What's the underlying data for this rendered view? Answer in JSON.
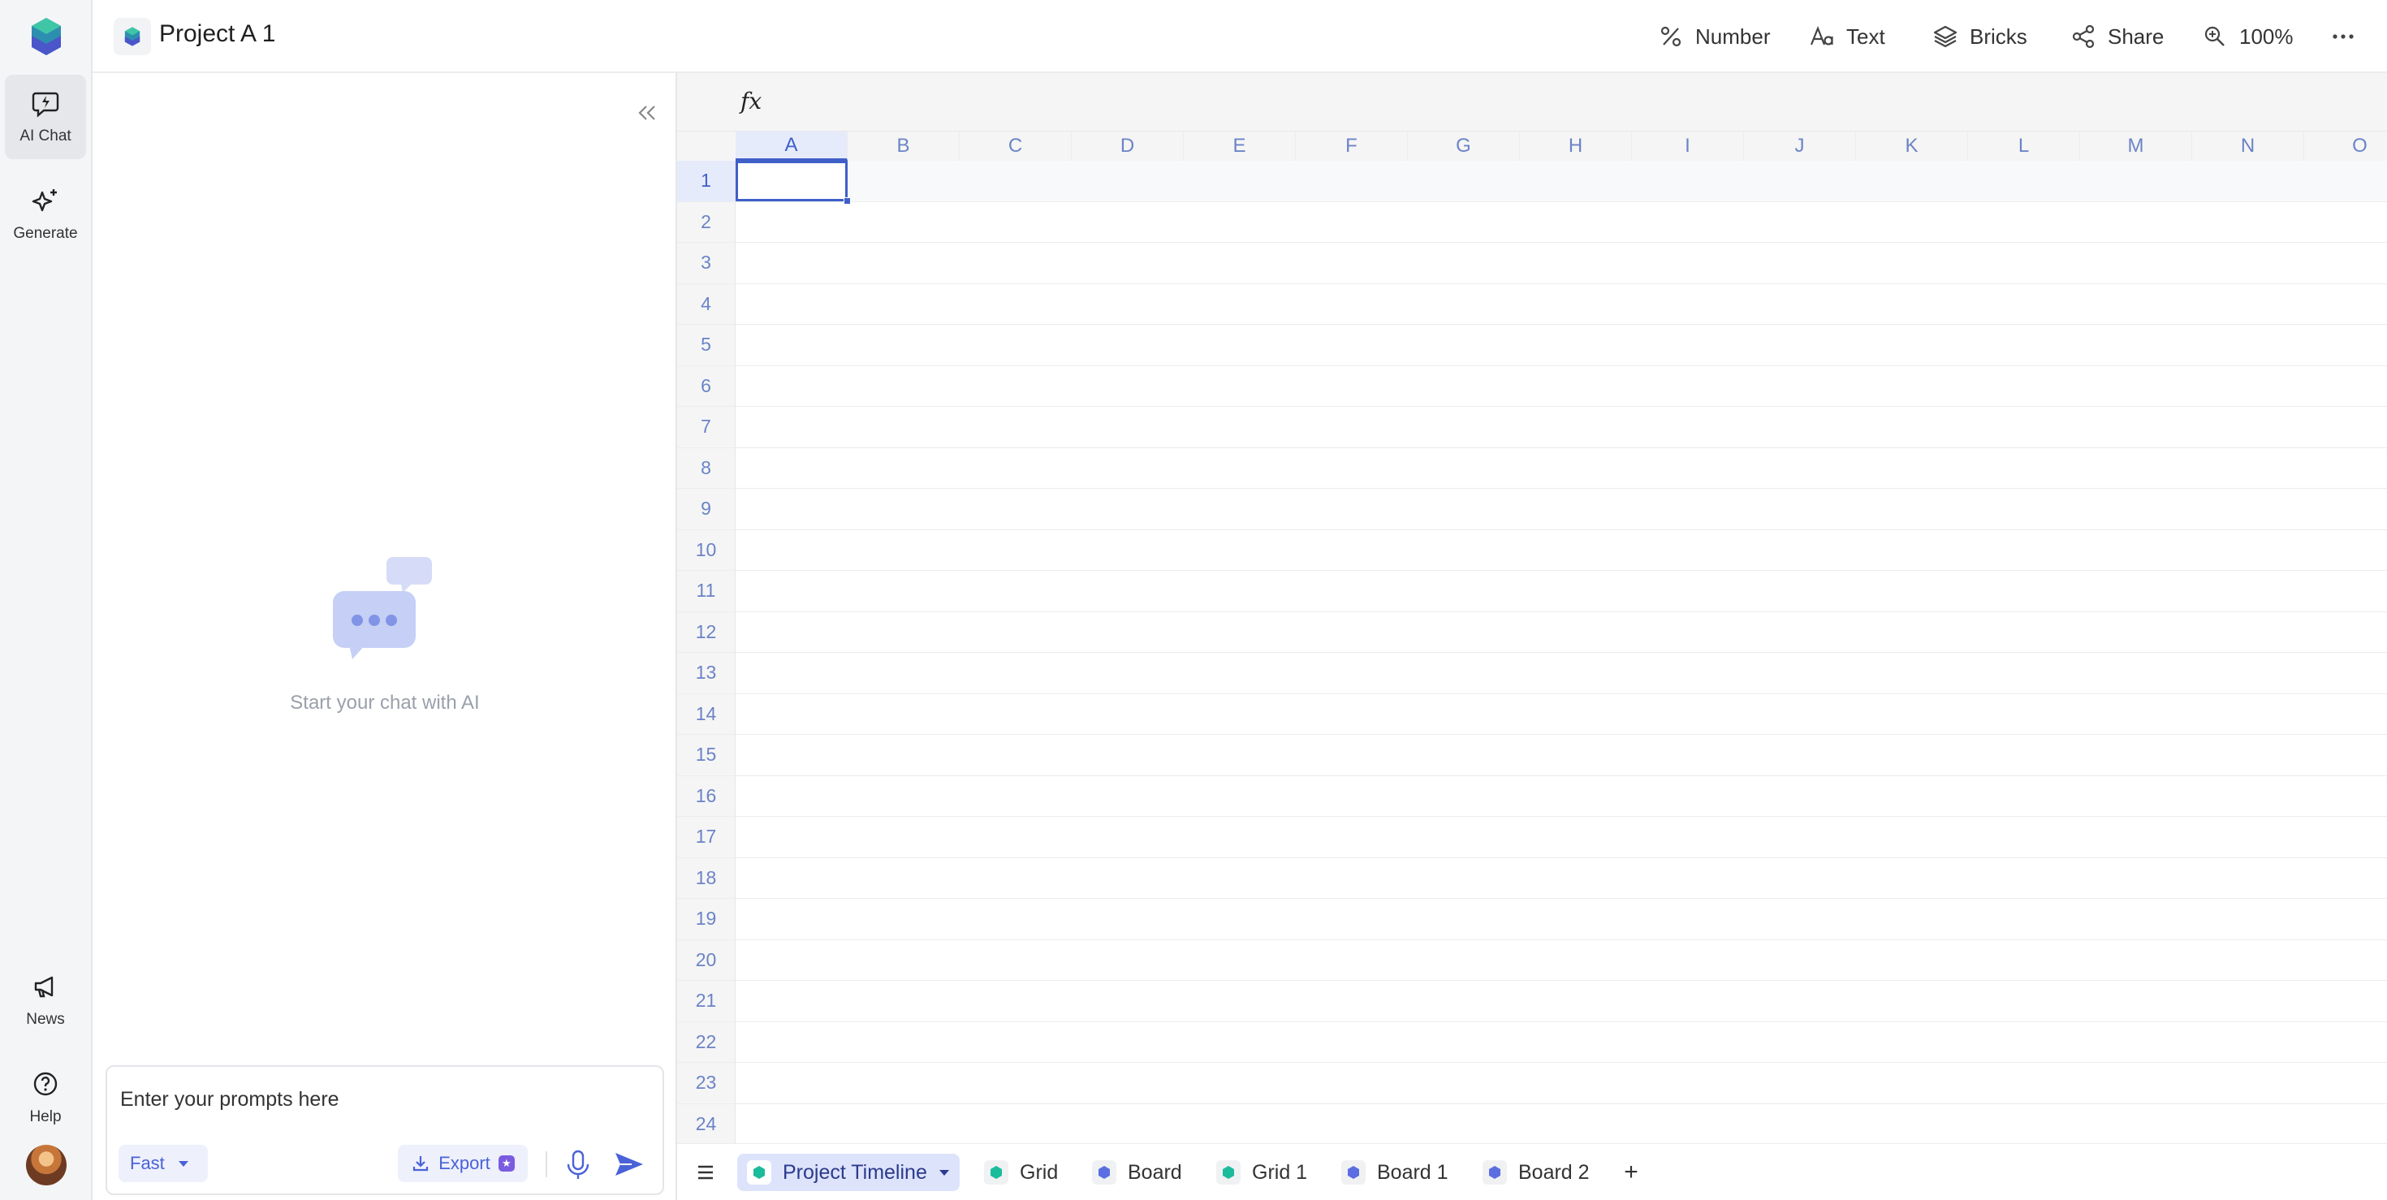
{
  "app": {
    "accent": "#3f5fc8",
    "teal": "#1abc9c",
    "indigo": "#5b6ee1"
  },
  "rail": {
    "items": [
      {
        "label": "AI Chat",
        "icon": "chat-bolt-icon",
        "active": true
      },
      {
        "label": "Generate",
        "icon": "sparkle-icon",
        "active": false
      }
    ],
    "bottom": [
      {
        "label": "News",
        "icon": "megaphone-icon"
      },
      {
        "label": "Help",
        "icon": "help-circle-icon"
      }
    ]
  },
  "header": {
    "title": "Project A 1",
    "tools": [
      {
        "label": "Number",
        "icon": "percent-icon"
      },
      {
        "label": "Text",
        "icon": "text-format-icon"
      },
      {
        "label": "Bricks",
        "icon": "layers-icon"
      },
      {
        "label": "Share",
        "icon": "share-icon"
      },
      {
        "label": "100%",
        "icon": "zoom-icon"
      }
    ]
  },
  "chat": {
    "empty_text": "Start your chat with AI",
    "placeholder": "Enter your prompts here",
    "mode": "Fast",
    "export_label": "Export"
  },
  "sheet": {
    "fx_label": "fx",
    "columns": [
      "A",
      "B",
      "C",
      "D",
      "E",
      "F",
      "G",
      "H",
      "I",
      "J",
      "K",
      "L",
      "M",
      "N",
      "O"
    ],
    "rows": [
      "1",
      "2",
      "3",
      "4",
      "5",
      "6",
      "7",
      "8",
      "9",
      "10",
      "11",
      "12",
      "13",
      "14",
      "15",
      "16",
      "17",
      "18",
      "19",
      "20",
      "21",
      "22",
      "23",
      "24"
    ],
    "selected_cell": "A1"
  },
  "tabs": [
    {
      "label": "Project Timeline",
      "color": "#1abc9c",
      "active": true
    },
    {
      "label": "Grid",
      "color": "#1abc9c",
      "active": false
    },
    {
      "label": "Board",
      "color": "#5b6ee1",
      "active": false
    },
    {
      "label": "Grid 1",
      "color": "#1abc9c",
      "active": false
    },
    {
      "label": "Board 1",
      "color": "#5b6ee1",
      "active": false
    },
    {
      "label": "Board 2",
      "color": "#5b6ee1",
      "active": false
    }
  ],
  "add_tab_label": "+"
}
